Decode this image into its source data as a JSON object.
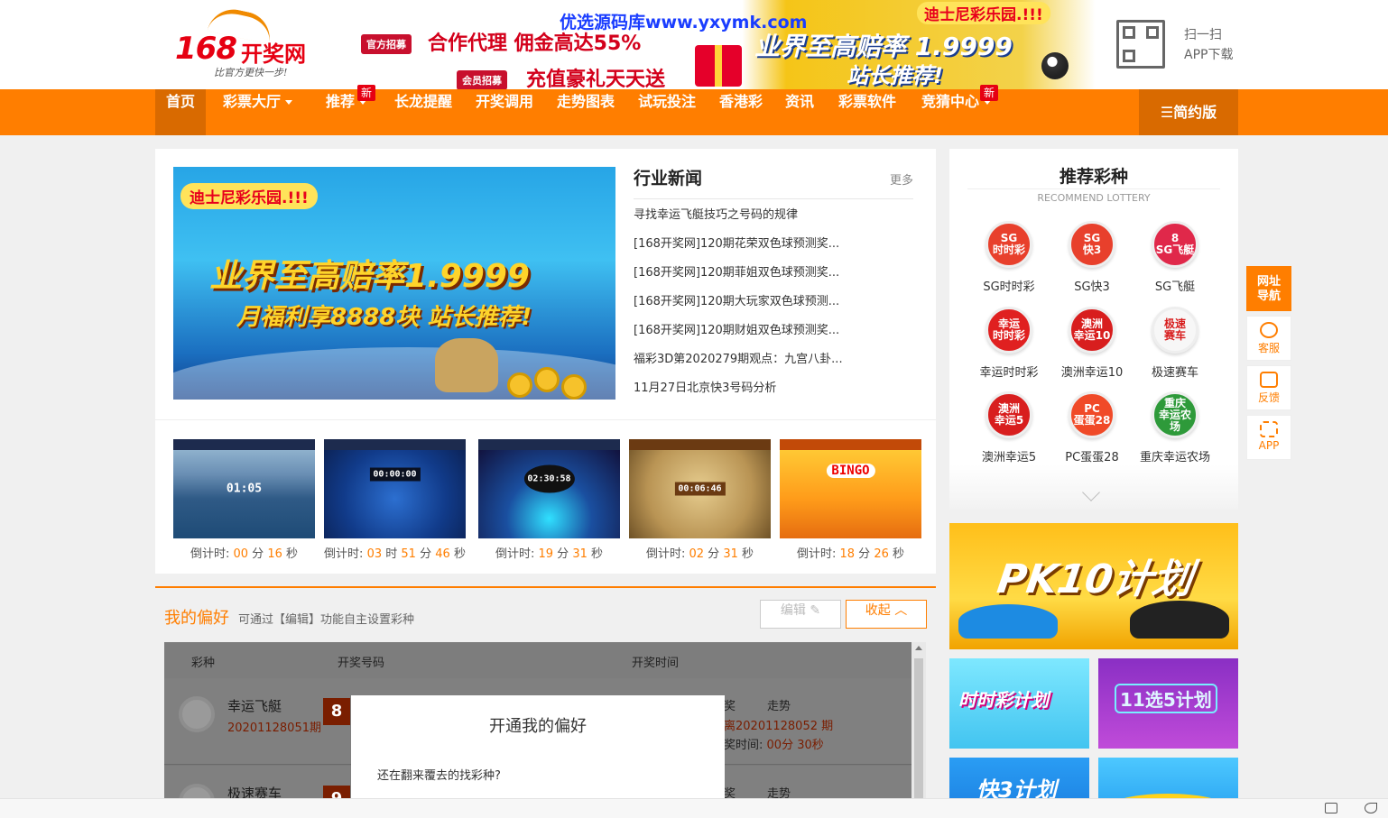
{
  "header": {
    "logo_number": "168",
    "logo_text": "开奖网",
    "logo_slogan": "比官方更快一步!",
    "banner": {
      "tag1": "官方招募",
      "line1": "合作代理 佣金高达55%",
      "tag2": "会员招募",
      "line2": "充值豪礼天天送",
      "brand": "迪士尼彩乐园.!!!",
      "rate": "业界至高赔率 1.9999",
      "push": "站长推荐!"
    },
    "watermark": "优选源码库www.yxymk.com",
    "qr_icon": "qrcode-icon",
    "app_line1": "扫一扫",
    "app_line2": "APP下载"
  },
  "nav": {
    "items": [
      {
        "label": "首页",
        "active": true
      },
      {
        "label": "彩票大厅",
        "caret": true
      },
      {
        "label": "推荐",
        "caret": true,
        "badge": "新"
      },
      {
        "label": "长龙提醒"
      },
      {
        "label": "开奖调用"
      },
      {
        "label": "走势图表"
      },
      {
        "label": "试玩投注"
      },
      {
        "label": "香港彩"
      },
      {
        "label": "资讯"
      },
      {
        "label": "彩票软件"
      },
      {
        "label": "竞猜中心",
        "caret": true,
        "badge": "新"
      }
    ],
    "simple": "☰简约版"
  },
  "slide": {
    "brand": "迪士尼彩乐园.!!!",
    "line1": "业界至高赔率1.9999",
    "line2": "月福利享8888块 站长推荐!"
  },
  "news": {
    "title": "行业新闻",
    "more": "更多",
    "items": [
      "寻找幸运飞艇技巧之号码的规律",
      "[168开奖网]120期花荣双色球预测奖...",
      "[168开奖网]120期菲姐双色球预测奖...",
      "[168开奖网]120期大玩家双色球预测...",
      "[168开奖网]120期财姐双色球预测奖...",
      "福彩3D第2020279期观点：九宫八卦...",
      "11月27日北京快3号码分析"
    ]
  },
  "games": [
    {
      "screen": "01:05",
      "label": "倒计时:",
      "parts": [
        [
          "00",
          "分"
        ],
        [
          "16",
          "秒"
        ]
      ]
    },
    {
      "screen": "00:00:00",
      "label": "倒计时:",
      "parts": [
        [
          "03",
          "时"
        ],
        [
          "51",
          "分"
        ],
        [
          "46",
          "秒"
        ]
      ]
    },
    {
      "screen": "02:30:58",
      "label": "倒计时:",
      "parts": [
        [
          "19",
          "分"
        ],
        [
          "31",
          "秒"
        ]
      ]
    },
    {
      "screen": "00:06:46",
      "label": "倒计时:",
      "parts": [
        [
          "02",
          "分"
        ],
        [
          "31",
          "秒"
        ]
      ]
    },
    {
      "screen": "BINGO",
      "label": "倒计时:",
      "parts": [
        [
          "18",
          "分"
        ],
        [
          "26",
          "秒"
        ]
      ]
    }
  ],
  "preference": {
    "title": "我的偏好",
    "subtitle": "可通过【编辑】功能自主设置彩种",
    "edit": "编辑",
    "fold": "收起",
    "columns": [
      "彩种",
      "开奖号码",
      "开奖时间"
    ],
    "rows": [
      {
        "name": "幸运飞艇",
        "period": "20201128051期",
        "ball": "8",
        "col_a": "奖",
        "col_b": "走势",
        "next": "离20201128052 期",
        "time_label": "奖时间:",
        "time_val": "00分 30秒"
      },
      {
        "name": "极速赛车",
        "period": "",
        "ball": "9",
        "col_a": "奖",
        "col_b": "走势"
      }
    ]
  },
  "modal": {
    "title": "开通我的偏好",
    "text": "还在翻来覆去的找彩种?"
  },
  "recommend": {
    "title": "推荐彩种",
    "subtitle": "RECOMMEND LOTTERY",
    "items": [
      {
        "label": "SG时时彩",
        "icon": "SG\n时时彩",
        "color": "#e8402c"
      },
      {
        "label": "SG快3",
        "icon": "SG\n快3",
        "color": "#e8402c"
      },
      {
        "label": "SG飞艇",
        "icon": "8\nSG飞艇",
        "color": "#e0284a"
      },
      {
        "label": "幸运时时彩",
        "icon": "幸运\n时时彩",
        "color": "#e02020"
      },
      {
        "label": "澳洲幸运10",
        "icon": "澳洲\n幸运10",
        "color": "#d81e1e"
      },
      {
        "label": "极速赛车",
        "icon": "极速\n赛车",
        "color": "#f7f7f7"
      },
      {
        "label": "澳洲幸运5",
        "icon": "澳洲\n幸运5",
        "color": "#d81e1e"
      },
      {
        "label": "PC蛋蛋28",
        "icon": "PC\n蛋蛋28",
        "color": "#f04a28"
      },
      {
        "label": "重庆幸运农场",
        "icon": "重庆\n幸运农场",
        "color": "#2e9a3a"
      }
    ]
  },
  "ads": {
    "pk10": "PK10计划",
    "ssc": "时时彩计划",
    "x115": "11选5计划",
    "k3": "快3计划"
  },
  "float": {
    "nav": "网址\n导航",
    "service": "客服",
    "feedback": "反馈",
    "app": "APP"
  }
}
